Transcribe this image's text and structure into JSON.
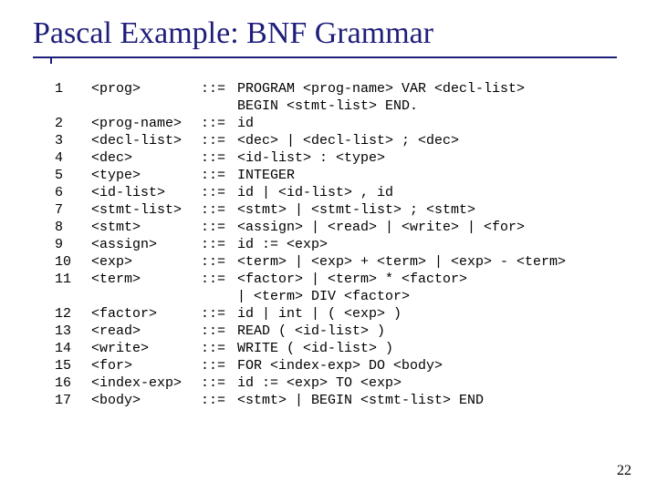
{
  "title": "Pascal Example: BNF Grammar",
  "page_number": "22",
  "separator": "::=",
  "rules": [
    {
      "num": "1",
      "lhs": "<prog>",
      "rhs": "PROGRAM <prog-name> VAR <decl-list>",
      "cont": "BEGIN <stmt-list> END."
    },
    {
      "num": "2",
      "lhs": "<prog-name>",
      "rhs": "id"
    },
    {
      "num": "3",
      "lhs": "<decl-list>",
      "rhs": "<dec> | <decl-list> ; <dec>"
    },
    {
      "num": "4",
      "lhs": "<dec>",
      "rhs": "<id-list> : <type>"
    },
    {
      "num": "5",
      "lhs": "<type>",
      "rhs": "INTEGER"
    },
    {
      "num": "6",
      "lhs": "<id-list>",
      "rhs": "id | <id-list> , id"
    },
    {
      "num": "7",
      "lhs": "<stmt-list>",
      "rhs": "<stmt> | <stmt-list> ; <stmt>"
    },
    {
      "num": "8",
      "lhs": "<stmt>",
      "rhs": "<assign> | <read> | <write> | <for>"
    },
    {
      "num": "9",
      "lhs": "<assign>",
      "rhs": "id := <exp>"
    },
    {
      "num": "10",
      "lhs": "<exp>",
      "rhs": "<term> | <exp> + <term> | <exp> - <term>"
    },
    {
      "num": "11",
      "lhs": "<term>",
      "rhs": "<factor> | <term> * <factor>",
      "cont": "| <term> DIV <factor>"
    },
    {
      "num": "12",
      "lhs": "<factor>",
      "rhs": "id | int | ( <exp> )"
    },
    {
      "num": "13",
      "lhs": "<read>",
      "rhs": "READ ( <id-list> )"
    },
    {
      "num": "14",
      "lhs": "<write>",
      "rhs": "WRITE ( <id-list> )"
    },
    {
      "num": "15",
      "lhs": "<for>",
      "rhs": "FOR <index-exp> DO <body>"
    },
    {
      "num": "16",
      "lhs": "<index-exp>",
      "rhs": "id := <exp> TO <exp>"
    },
    {
      "num": "17",
      "lhs": "<body>",
      "rhs": "<stmt> | BEGIN <stmt-list> END"
    }
  ]
}
